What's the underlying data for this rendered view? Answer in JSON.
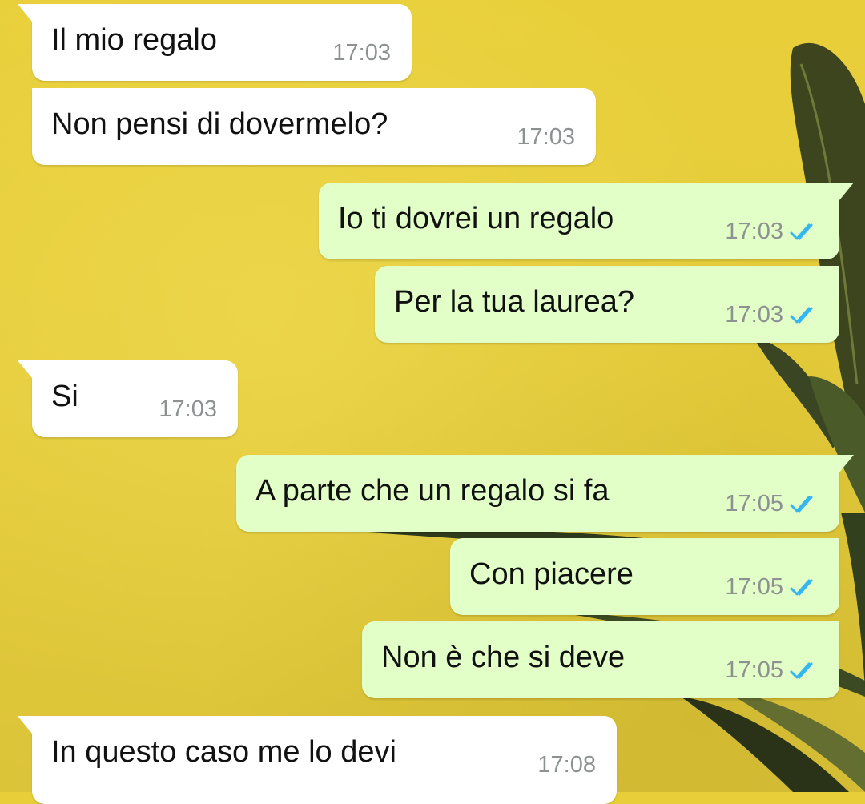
{
  "chat": {
    "messages": [
      {
        "direction": "incoming",
        "text": "Il mio regalo",
        "time": "17:03"
      },
      {
        "direction": "incoming",
        "text": "Non pensi di dovermelo?",
        "time": "17:03"
      },
      {
        "direction": "outgoing",
        "text": "Io ti dovrei un regalo",
        "time": "17:03",
        "status": "read"
      },
      {
        "direction": "outgoing",
        "text": "Per la tua laurea?",
        "time": "17:03",
        "status": "read"
      },
      {
        "direction": "incoming",
        "text": "Si",
        "time": "17:03"
      },
      {
        "direction": "outgoing",
        "text": "A parte che un regalo si fa",
        "time": "17:05",
        "status": "read"
      },
      {
        "direction": "outgoing",
        "text": "Con piacere",
        "time": "17:05",
        "status": "read"
      },
      {
        "direction": "outgoing",
        "text": "Non è che si deve",
        "time": "17:05",
        "status": "read"
      },
      {
        "direction": "incoming",
        "text": "In questo caso me lo devi",
        "time": "17:08"
      }
    ]
  },
  "colors": {
    "wallpaper": "#e5cc3a",
    "incoming_bubble": "#ffffff",
    "outgoing_bubble": "#e2ffc7",
    "read_ticks": "#34b7f1"
  },
  "icons": {
    "read_receipt": "double-check-icon"
  }
}
